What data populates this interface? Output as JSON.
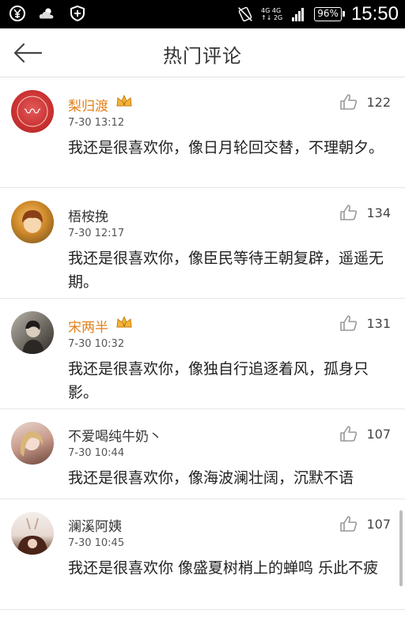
{
  "status_bar": {
    "left_icons": [
      "yen-shield-icon",
      "weather-icon",
      "shield-icon"
    ],
    "network_top": "4G 4G",
    "network_bottom": "↑↓ 2G",
    "battery": "96%",
    "time": "15:50"
  },
  "header": {
    "title": "热门评论",
    "back_icon": "back-arrow-icon"
  },
  "comments": [
    {
      "user": "梨归渡",
      "vip": true,
      "time": "7-30 13:12",
      "text": "我还是很喜欢你，像日月轮回交替，不理朝夕。",
      "likes": "122"
    },
    {
      "user": "梧桉挽",
      "vip": false,
      "time": "7-30 12:17",
      "text": "我还是很喜欢你，像臣民等待王朝复辟，遥遥无期。",
      "likes": "134"
    },
    {
      "user": "宋两半",
      "vip": true,
      "time": "7-30 10:32",
      "text": "我还是很喜欢你，像独自行追逐着风，孤身只影。",
      "likes": "131"
    },
    {
      "user": "不爱喝纯牛奶丶",
      "vip": false,
      "time": "7-30 10:44",
      "text": "我还是很喜欢你，像海波澜壮阔，沉默不语",
      "likes": "107"
    },
    {
      "user": "澜溪阿姨",
      "vip": false,
      "time": "7-30 10:45",
      "text": "我还是很喜欢你 像盛夏树梢上的蝉鸣 乐此不疲",
      "likes": "107"
    }
  ],
  "colors": {
    "vip_name": "#e2801a",
    "status_bar_bg": "#000000"
  }
}
